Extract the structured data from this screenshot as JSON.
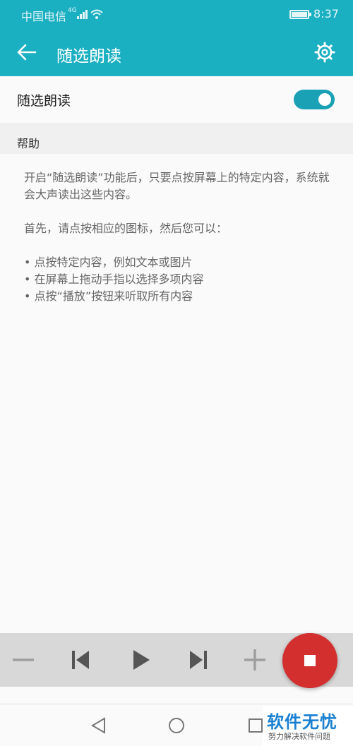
{
  "status_bar": {
    "carrier": "中国电信",
    "network": "4G",
    "time": "8:37",
    "icons": [
      "signal-icon",
      "wifi-icon",
      "battery-icon"
    ]
  },
  "app_bar": {
    "title": "随选朗读",
    "icons": [
      "back-arrow-icon",
      "gear-icon"
    ]
  },
  "toggle": {
    "label": "随选朗读",
    "on": true,
    "accent": "#1aa1b6"
  },
  "help": {
    "header": "帮助",
    "intro": "开启“随选朗读”功能后，只要点按屏幕上的特定内容，系统就会大声读出这些内容。",
    "steps_intro": "首先，请点按相应的图标，然后您可以：",
    "bullets": [
      "• 点按特定内容，例如文本或图片",
      "• 在屏幕上拖动手指以选择多项内容",
      "• 点按“播放”按钮来听取所有内容"
    ]
  },
  "player": {
    "icons": [
      "minus-icon",
      "previous-icon",
      "play-icon",
      "next-icon",
      "plus-icon",
      "stop-icon"
    ],
    "stop_color": "#d32f2f"
  },
  "nav_bar": {
    "icons": [
      "back-triangle-icon",
      "home-circle-icon",
      "recents-square-icon"
    ]
  },
  "watermark": {
    "brand": "软件无忧",
    "sub": "努力解决软件问题"
  },
  "colors": {
    "primary": "#1aafc1",
    "background": "#fafafa"
  }
}
